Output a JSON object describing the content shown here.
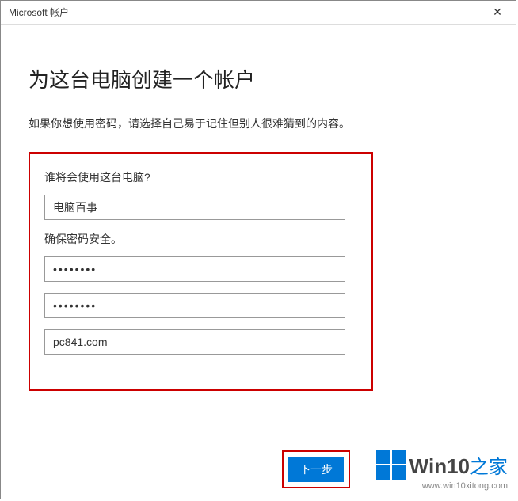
{
  "titlebar": {
    "title": "Microsoft 帐户",
    "close_glyph": "✕"
  },
  "page": {
    "title": "为这台电脑创建一个帐户",
    "subtitle": "如果你想使用密码，请选择自己易于记住但别人很难猜到的内容。"
  },
  "form": {
    "who_label": "谁将会使用这台电脑?",
    "username_value": "电脑百事",
    "secure_label": "确保密码安全。",
    "password_value": "••••••••",
    "password_confirm_value": "••••••••",
    "hint_value": "pc841.com"
  },
  "footer": {
    "next_label": "下一步"
  },
  "watermark": {
    "brand_en": "Win10",
    "brand_zh": "之家",
    "url": "www.win10xitong.com"
  }
}
